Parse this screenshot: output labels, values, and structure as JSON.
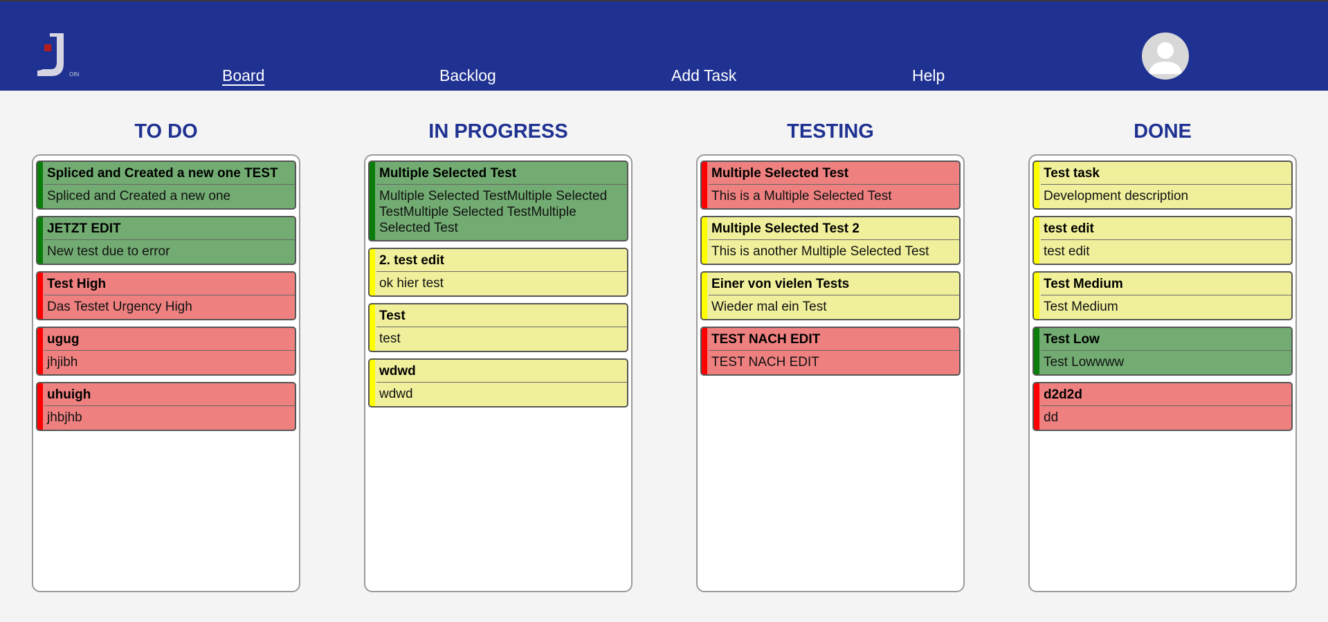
{
  "header": {
    "logo_text": "OIN",
    "nav": [
      "Board",
      "Backlog",
      "Add Task",
      "Help"
    ],
    "active": "Board"
  },
  "colors": {
    "header": "#1f3191",
    "high": "#ee8080",
    "medium": "#f0f09c",
    "low": "#72ac72"
  },
  "columns": [
    {
      "title": "TO DO",
      "cards": [
        {
          "title": "Spliced and Created a new one TEST",
          "desc": "Spliced and Created a new one",
          "urgency": "low"
        },
        {
          "title": "JETZT EDIT",
          "desc": "New test due to error",
          "urgency": "low"
        },
        {
          "title": "Test High",
          "desc": "Das Testet Urgency High",
          "urgency": "high"
        },
        {
          "title": "ugug",
          "desc": "jhjibh",
          "urgency": "high"
        },
        {
          "title": "uhuigh",
          "desc": "jhbjhb",
          "urgency": "high"
        }
      ]
    },
    {
      "title": "IN PROGRESS",
      "cards": [
        {
          "title": "Multiple Selected Test",
          "desc": "Multiple Selected TestMultiple Selected TestMultiple Selected TestMultiple Selected Test",
          "urgency": "low"
        },
        {
          "title": "2. test edit",
          "desc": "ok hier test",
          "urgency": "medium"
        },
        {
          "title": "Test",
          "desc": "test",
          "urgency": "medium"
        },
        {
          "title": "wdwd",
          "desc": "wdwd",
          "urgency": "medium"
        }
      ]
    },
    {
      "title": "TESTING",
      "cards": [
        {
          "title": "Multiple Selected Test",
          "desc": "This is a Multiple Selected Test",
          "urgency": "high"
        },
        {
          "title": "Multiple Selected Test 2",
          "desc": "This is another Multiple Selected Test",
          "urgency": "medium"
        },
        {
          "title": "Einer von vielen Tests",
          "desc": "Wieder mal ein Test",
          "urgency": "medium"
        },
        {
          "title": "TEST NACH EDIT",
          "desc": "TEST NACH EDIT",
          "urgency": "high"
        }
      ]
    },
    {
      "title": "DONE",
      "cards": [
        {
          "title": "Test task",
          "desc": "Development description",
          "urgency": "medium"
        },
        {
          "title": "test edit",
          "desc": "test edit",
          "urgency": "medium"
        },
        {
          "title": "Test Medium",
          "desc": "Test Medium",
          "urgency": "medium"
        },
        {
          "title": "Test Low",
          "desc": "Test Lowwww",
          "urgency": "low"
        },
        {
          "title": "d2d2d",
          "desc": "dd",
          "urgency": "high"
        }
      ]
    }
  ]
}
